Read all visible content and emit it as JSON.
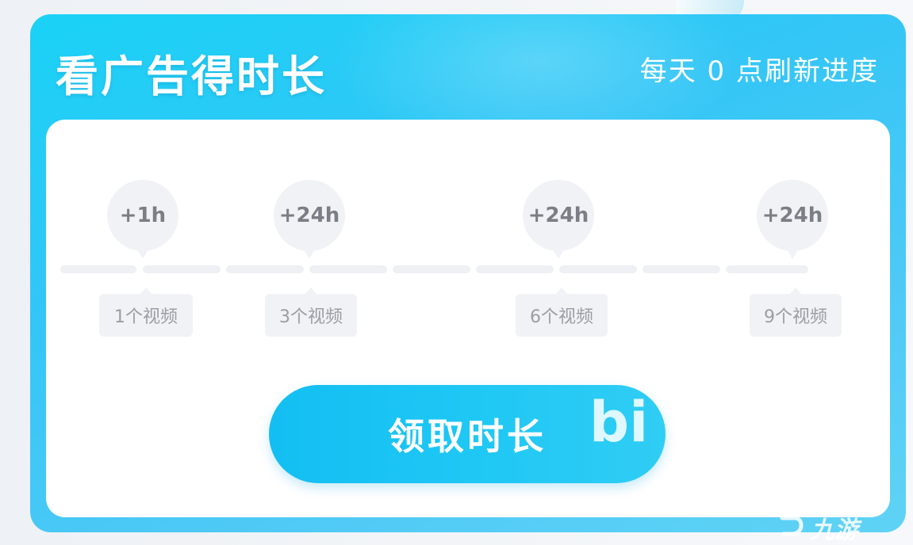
{
  "card": {
    "title": "看广告得时长",
    "refresh_note": "每天 0 点刷新进度"
  },
  "rewards": [
    {
      "label": "+1h"
    },
    {
      "label": "+24h"
    },
    {
      "label": "+24h"
    },
    {
      "label": "+24h"
    }
  ],
  "milestones": [
    {
      "label": "1个视频"
    },
    {
      "label": "3个视频"
    },
    {
      "label": "6个视频"
    },
    {
      "label": "9个视频"
    }
  ],
  "progress": {
    "watched_videos": 0,
    "total_videos": 9
  },
  "claim_button": {
    "label": "领取时长",
    "decoration_text": "bi"
  },
  "watermark": {
    "text": "九游",
    "icon": "jiuyou-logo-icon"
  },
  "colors": {
    "card_gradient_start": "#1ad2f6",
    "card_gradient_end": "#5fd3f5",
    "button": "#1ec7f4",
    "panel": "#ffffff",
    "track": "#eef0f4",
    "bubble": "#f1f2f6"
  }
}
